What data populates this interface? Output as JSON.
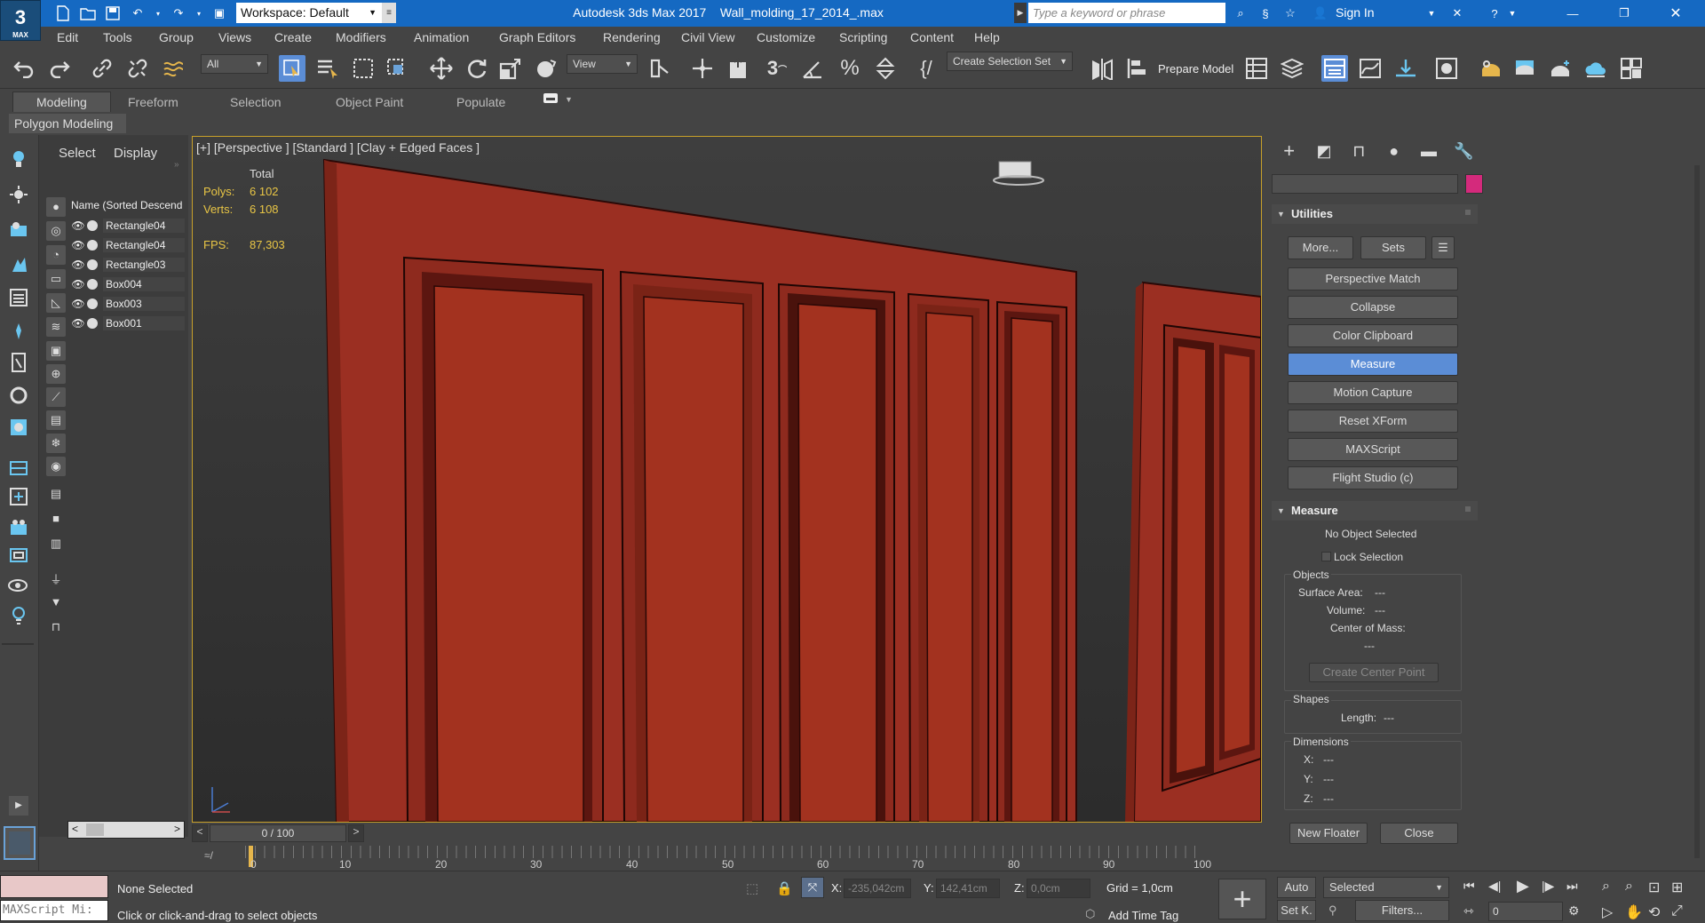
{
  "app": {
    "title": "Autodesk 3ds Max 2017",
    "file": "Wall_molding_17_2014_.max",
    "logo": "3",
    "logo_sub": "MAX",
    "workspace": "Workspace: Default",
    "search_placeholder": "Type a keyword or phrase",
    "sign_in": "Sign In"
  },
  "menu": [
    "Edit",
    "Tools",
    "Group",
    "Views",
    "Create",
    "Modifiers",
    "Animation",
    "Graph Editors",
    "Rendering",
    "Civil View",
    "Customize",
    "Scripting",
    "Content",
    "Help"
  ],
  "toolbar": {
    "filter": "All",
    "ref_coord": "View",
    "selection_set": "Create Selection Set",
    "prepare_model": "Prepare Model"
  },
  "ribbon": {
    "tabs": [
      "Modeling",
      "Freeform",
      "Selection",
      "Object Paint",
      "Populate"
    ],
    "active_tab": "Modeling",
    "subtitle": "Polygon Modeling"
  },
  "explorer": {
    "tab_select": "Select",
    "tab_display": "Display",
    "column": "Name (Sorted Descend",
    "items": [
      "Rectangle04",
      "Rectangle04",
      "Rectangle03",
      "Box004",
      "Box003",
      "Box001"
    ]
  },
  "viewport": {
    "label": "[+] [Perspective ] [Standard ] [Clay + Edged Faces ]",
    "total_label": "Total",
    "polys_label": "Polys:",
    "polys": "6 102",
    "verts_label": "Verts:",
    "verts": "6 108",
    "fps_label": "FPS:",
    "fps": "87,303",
    "model_color": "#9b2f22"
  },
  "timeline": {
    "frame": "0 / 100",
    "ticks": [
      "0",
      "10",
      "20",
      "30",
      "40",
      "50",
      "60",
      "70",
      "80",
      "90",
      "100"
    ]
  },
  "command_panel": {
    "utilities_title": "Utilities",
    "more": "More...",
    "sets": "Sets",
    "buttons": [
      "Perspective Match",
      "Collapse",
      "Color Clipboard",
      "Measure",
      "Motion Capture",
      "Reset XForm",
      "MAXScript",
      "Flight Studio (c)"
    ],
    "active_button": "Measure",
    "measure_title": "Measure",
    "no_object": "No Object Selected",
    "lock_selection": "Lock Selection",
    "objects_group": "Objects",
    "surface_area": "Surface Area:",
    "volume": "Volume:",
    "center_of_mass": "Center of Mass:",
    "placeholder": "---",
    "create_center_point": "Create Center Point",
    "shapes_group": "Shapes",
    "length": "Length:",
    "dimensions_group": "Dimensions",
    "x": "X:",
    "y": "Y:",
    "z": "Z:",
    "new_floater": "New Floater",
    "close": "Close",
    "swatch_color": "#d42a7c"
  },
  "status": {
    "maxscript": "MAXScript Mi:",
    "none_selected": "None Selected",
    "prompt": "Click or click-and-drag to select objects",
    "x_label": "X:",
    "x": "-235,042cm",
    "y_label": "Y:",
    "y": "142,41cm",
    "z_label": "Z:",
    "z": "0,0cm",
    "grid": "Grid = 1,0cm",
    "add_time_tag": "Add Time Tag",
    "auto": "Auto",
    "selected": "Selected",
    "set_key": "Set K.",
    "filters": "Filters...",
    "frame": "0"
  }
}
